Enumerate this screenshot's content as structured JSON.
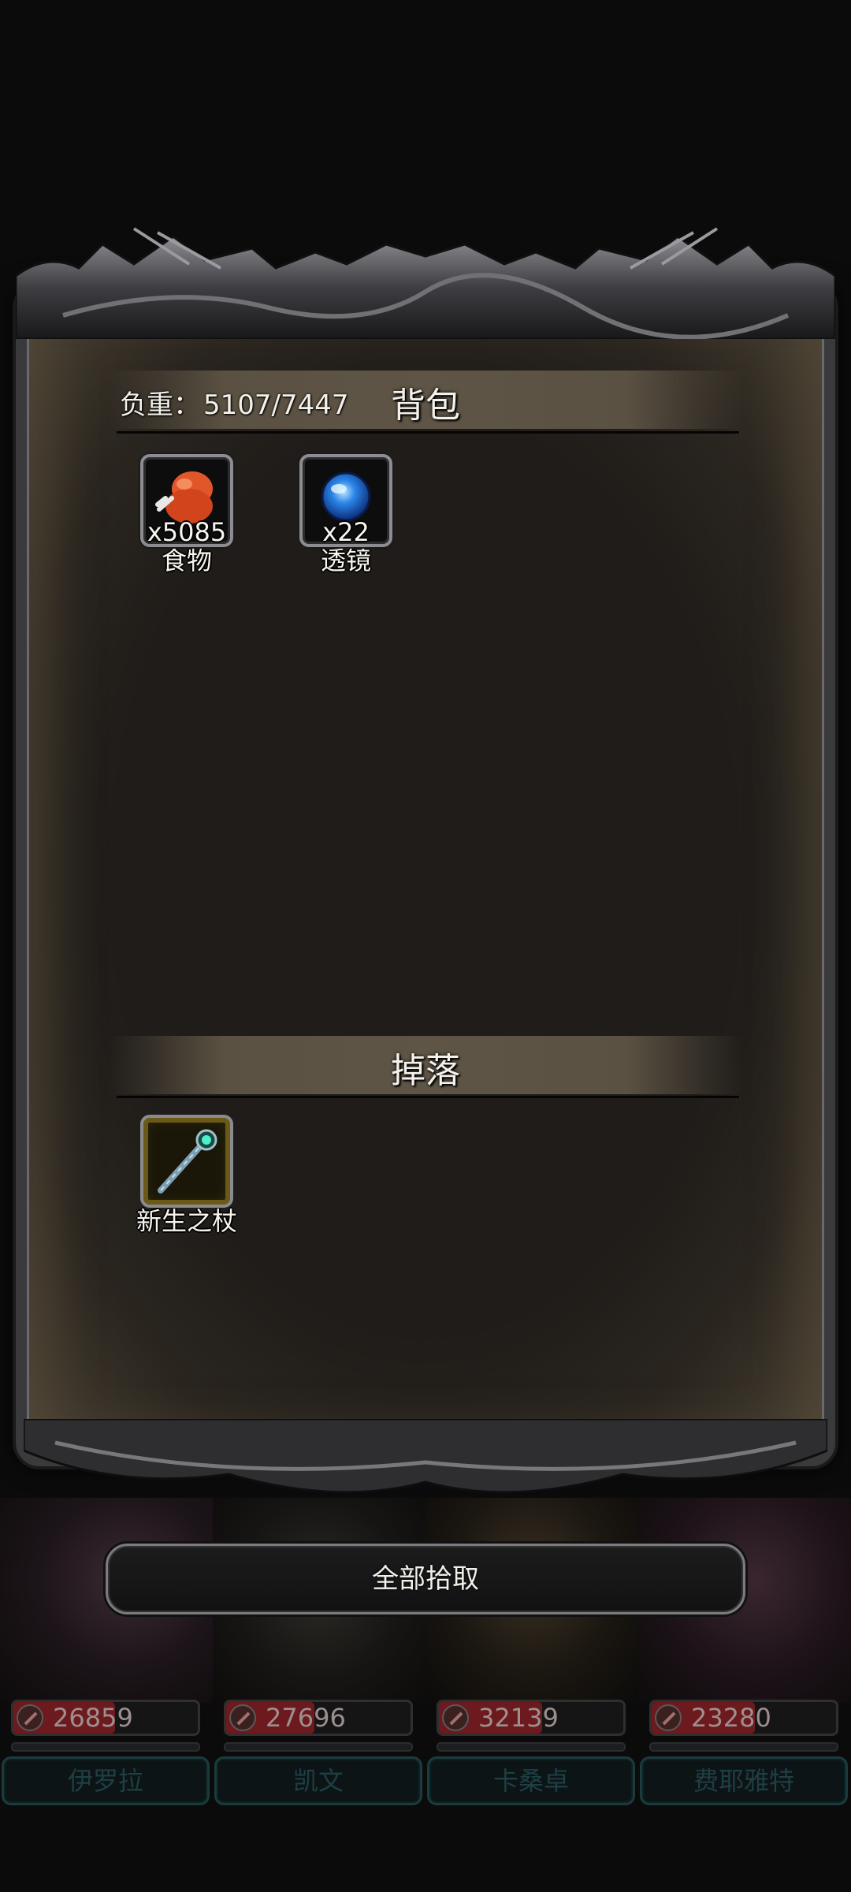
{
  "bag": {
    "weight_label": "负重：",
    "weight_value": "5107/7447",
    "title": "背包",
    "items": [
      {
        "name": "食物",
        "qty": "x5085",
        "icon": "meat-icon"
      },
      {
        "name": "透镜",
        "qty": "x22",
        "icon": "blue-orb-icon"
      }
    ]
  },
  "drops": {
    "title": "掉落",
    "items": [
      {
        "name": "新生之杖",
        "icon": "staff-icon"
      }
    ]
  },
  "pickup_all_label": "全部拾取",
  "heroes": [
    {
      "name": "伊罗拉",
      "hp": "26859",
      "hp_fraction": 0.55
    },
    {
      "name": "凯文",
      "hp": "27696",
      "hp_fraction": 0.48
    },
    {
      "name": "卡桑卓",
      "hp": "32139",
      "hp_fraction": 0.56
    },
    {
      "name": "费耶雅特",
      "hp": "23280",
      "hp_fraction": 0.56
    }
  ],
  "colors": {
    "panel": "#1f1c19",
    "header_bar": "#5e5546",
    "hp_fill": "#6c1a1d",
    "hero_name": "#1e3f44"
  }
}
